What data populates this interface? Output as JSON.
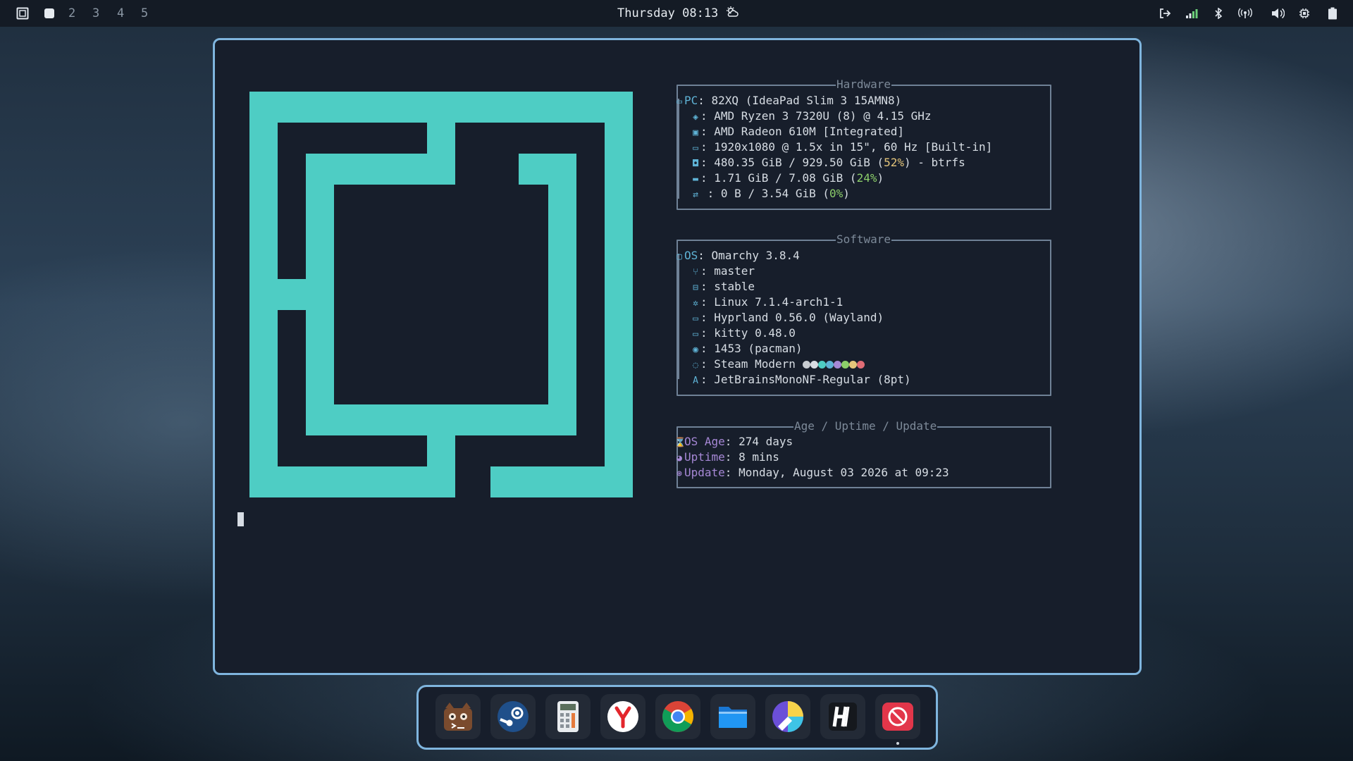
{
  "topbar": {
    "workspaces": [
      "2",
      "3",
      "4",
      "5"
    ],
    "clock": "Thursday 08:13"
  },
  "icons": {
    "launcher": "app-launcher-icon",
    "weather": "partly-cloudy-icon",
    "logout": "logout-icon",
    "wifi": "wifi-icon",
    "bluetooth": "bluetooth-icon",
    "network": "network-icon",
    "volume": "volume-icon",
    "cpu": "cpu-icon",
    "battery": "battery-icon"
  },
  "colors": {
    "accent": "#4ecdc4",
    "border": "#7fb5de",
    "key": "#5fb3d6",
    "purple": "#a688d6"
  },
  "hardware": {
    "title": "Hardware",
    "pc_key": "PC",
    "pc": "82XQ (IdeaPad Slim 3 15AMN8)",
    "cpu": "AMD Ryzen 3 7320U (8) @ 4.15 GHz",
    "gpu": "AMD Radeon 610M [Integrated]",
    "display": "1920x1080 @ 1.5x in 15\", 60 Hz [Built-in]",
    "disk_prefix": "480.35 GiB / 929.50 GiB (",
    "disk_pct": "52%",
    "disk_suffix": ") - btrfs",
    "mem_prefix": "1.71 GiB / 7.08 GiB (",
    "mem_pct": "24%",
    "mem_suffix": ")",
    "swap_prefix": "0 B / 3.54 GiB (",
    "swap_pct": "0%",
    "swap_suffix": ")"
  },
  "software": {
    "title": "Software",
    "os_key": "OS",
    "os": "Omarchy 3.8.4",
    "branch": "master",
    "channel": "stable",
    "kernel": "Linux 7.1.4-arch1-1",
    "wm": "Hyprland 0.56.0 (Wayland)",
    "terminal": "kitty 0.48.0",
    "packages": "1453 (pacman)",
    "theme": "Steam Modern",
    "theme_colors": [
      "#c8ccd2",
      "#d8dce2",
      "#4ecdc4",
      "#5fb3d6",
      "#a688d6",
      "#8ccf6a",
      "#e4c57a",
      "#e06c75"
    ],
    "font_icon": "A",
    "font": "JetBrainsMonoNF-Regular (8pt)"
  },
  "age": {
    "title": "Age / Uptime / Update",
    "os_age_key": "OS Age",
    "os_age": "274 days",
    "uptime_key": "Uptime",
    "uptime": "8 mins",
    "update_key": "Update",
    "update": "Monday, August 03 2026 at 09:23"
  },
  "dock": {
    "apps": [
      "terminal-app",
      "steam-app",
      "calculator-app",
      "yandex-browser-app",
      "chrome-app",
      "files-app",
      "color-picker-app",
      "hyprland-app",
      "blocked-app"
    ]
  }
}
